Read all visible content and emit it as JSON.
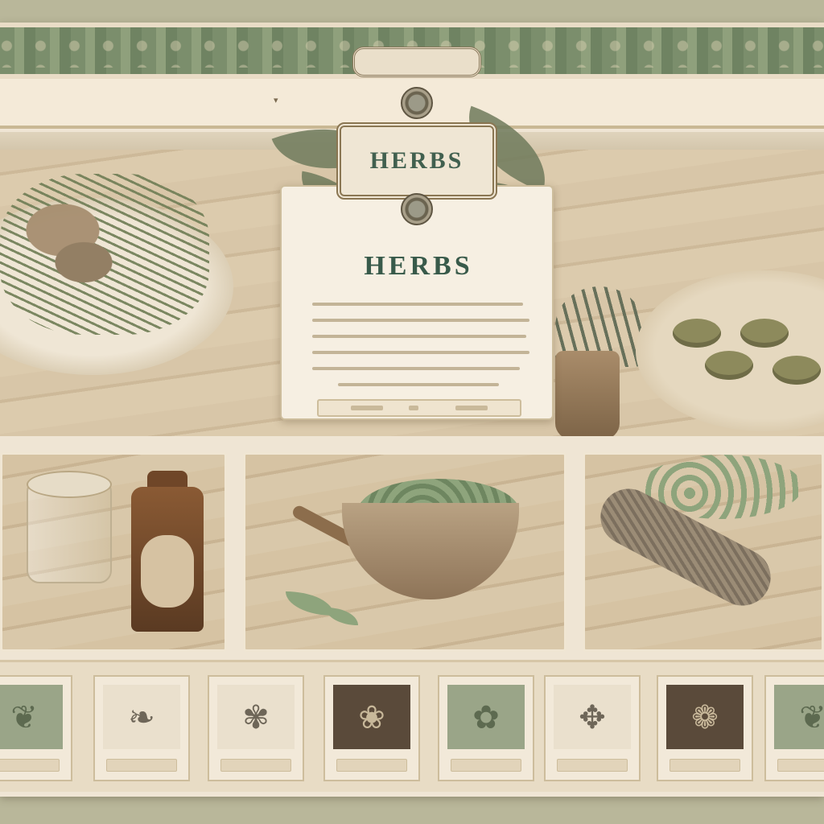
{
  "header": {
    "badge_text": "",
    "nav_left": [
      "",
      "",
      ""
    ],
    "nav_right": [
      "",
      "",
      ""
    ]
  },
  "hero": {
    "crest_label": "HERBS",
    "card_title": "HERBS"
  },
  "tiles": [
    {
      "icon": "sprig-icon",
      "style": "sage"
    },
    {
      "icon": "leaf-icon",
      "style": "cream"
    },
    {
      "icon": "lavender-icon",
      "style": "cream"
    },
    {
      "icon": "oak-leaf-icon",
      "style": "dark"
    },
    {
      "icon": "flower-icon",
      "style": "sage"
    },
    {
      "icon": "maple-leaf-icon",
      "style": "cream"
    },
    {
      "icon": "rose-icon",
      "style": "dark"
    },
    {
      "icon": "fern-icon",
      "style": "sage"
    }
  ],
  "colors": {
    "accent_green": "#385a4a",
    "sage": "#9aa588",
    "parchment": "#efe5d4",
    "border_tan": "#cdbd9c"
  }
}
